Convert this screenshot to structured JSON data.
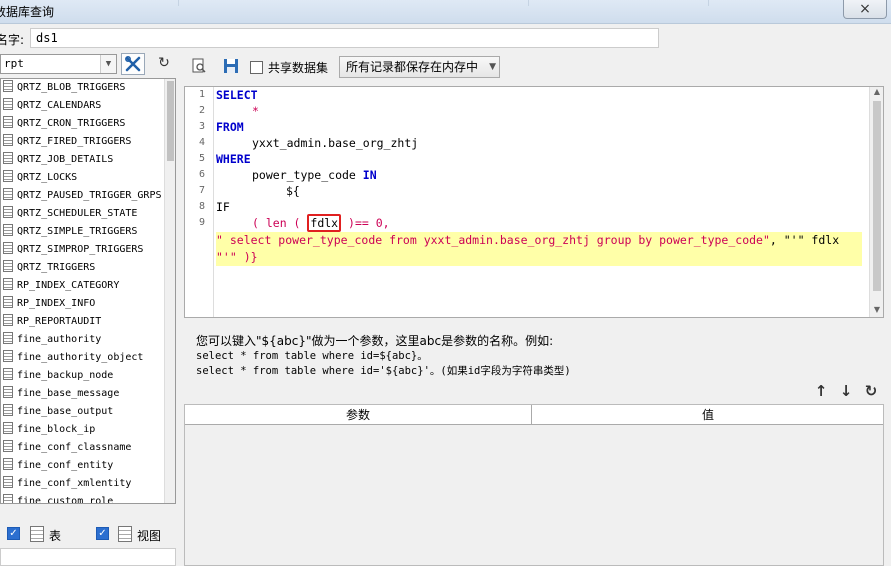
{
  "window": {
    "title": "数据库查询",
    "close_icon": "×"
  },
  "name_field": {
    "label": "名字:",
    "value": "ds1"
  },
  "left": {
    "db_select": "rpt",
    "tables": [
      "QRTZ_BLOB_TRIGGERS",
      "QRTZ_CALENDARS",
      "QRTZ_CRON_TRIGGERS",
      "QRTZ_FIRED_TRIGGERS",
      "QRTZ_JOB_DETAILS",
      "QRTZ_LOCKS",
      "QRTZ_PAUSED_TRIGGER_GRPS",
      "QRTZ_SCHEDULER_STATE",
      "QRTZ_SIMPLE_TRIGGERS",
      "QRTZ_SIMPROP_TRIGGERS",
      "QRTZ_TRIGGERS",
      "RP_INDEX_CATEGORY",
      "RP_INDEX_INFO",
      "RP_REPORTAUDIT",
      "fine_authority",
      "fine_authority_object",
      "fine_backup_node",
      "fine_base_message",
      "fine_base_output",
      "fine_block_ip",
      "fine_conf_classname",
      "fine_conf_entity",
      "fine_conf_xmlentity",
      "fine_custom_role"
    ],
    "show_tables_label": "表",
    "show_views_label": "视图"
  },
  "toolbar": {
    "share_label": "共享数据集",
    "memory_mode": "所有记录都保存在内存中"
  },
  "editor": {
    "line_numbers": [
      "1",
      "2",
      "3",
      "4",
      "5",
      "6",
      "7",
      "8",
      "9"
    ],
    "lines": {
      "l1": "SELECT",
      "l2": "*",
      "l3": "FROM",
      "l4": "yxxt_admin.base_org_zhtj",
      "l5_a": "power_type_code",
      "l5_b": "IN",
      "l6": "${",
      "l7": "IF",
      "l8_a": "( len (",
      "l8_box": "fdlx",
      "l8_b": ")== 0,",
      "l9_str": "\" select power_type_code from yxxt_admin.base_org_zhtj group by power_type_code\"",
      "l9_rest": ", \"'\" fdlx",
      "l10_str": "\"'\"",
      "l10_rest": " )}"
    }
  },
  "hints": {
    "line1": "您可以键入\"${abc}\"做为一个参数，这里abc是参数的名称。例如:",
    "line2": "select * from table where id=${abc}。",
    "line3": "select * from table where id='${abc}'。(如果id字段为字符串类型)"
  },
  "params": {
    "col_name": "参数",
    "col_value": "值"
  }
}
